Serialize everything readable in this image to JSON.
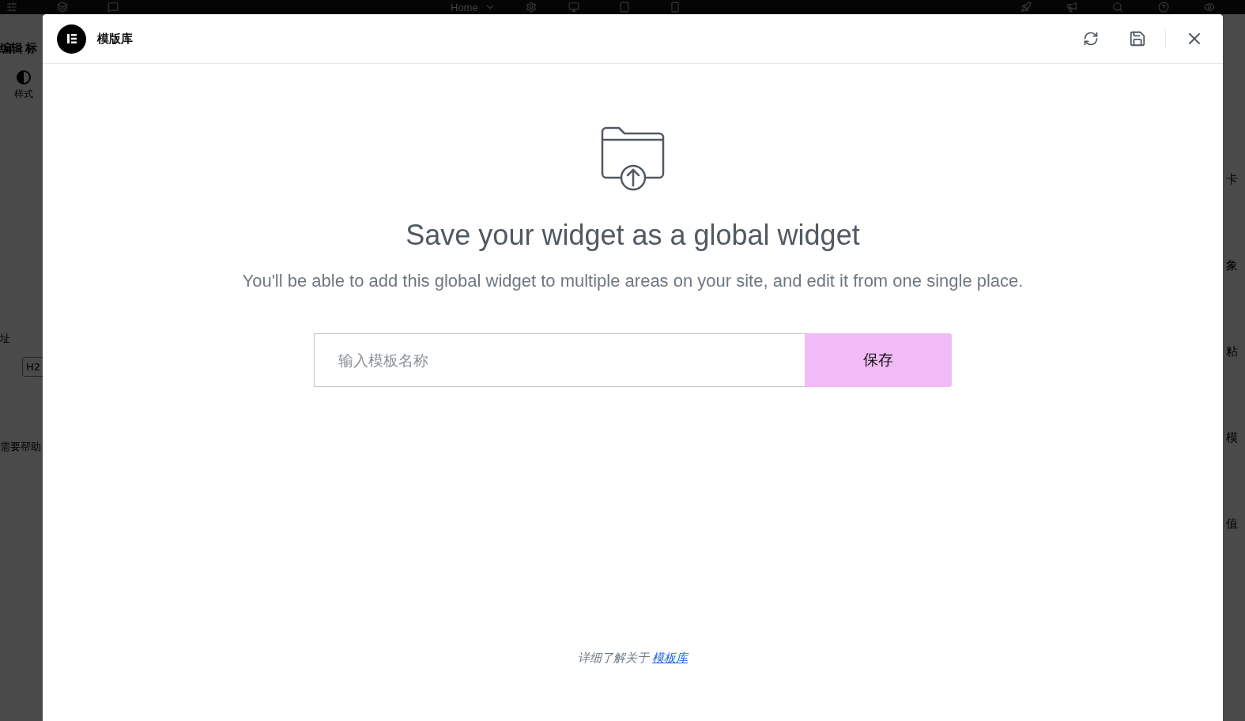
{
  "top_bar": {
    "page": "Home"
  },
  "left_panel": {
    "title": "编辑 标",
    "tab": "样式",
    "field_label": "址",
    "tag": "H2",
    "help": "需要帮助"
  },
  "right_panel": {
    "labels": [
      "卡",
      "象",
      "粘",
      "模",
      "值"
    ]
  },
  "modal": {
    "title": "模版库",
    "heading": "Save your widget as a global widget",
    "description": "You'll be able to add this global widget to multiple areas on your site, and edit it from one single place.",
    "name_field": {
      "placeholder": "输入模板名称"
    },
    "save_button": "保存",
    "footer": {
      "text": "详细了解关于",
      "link": "模板库"
    }
  }
}
